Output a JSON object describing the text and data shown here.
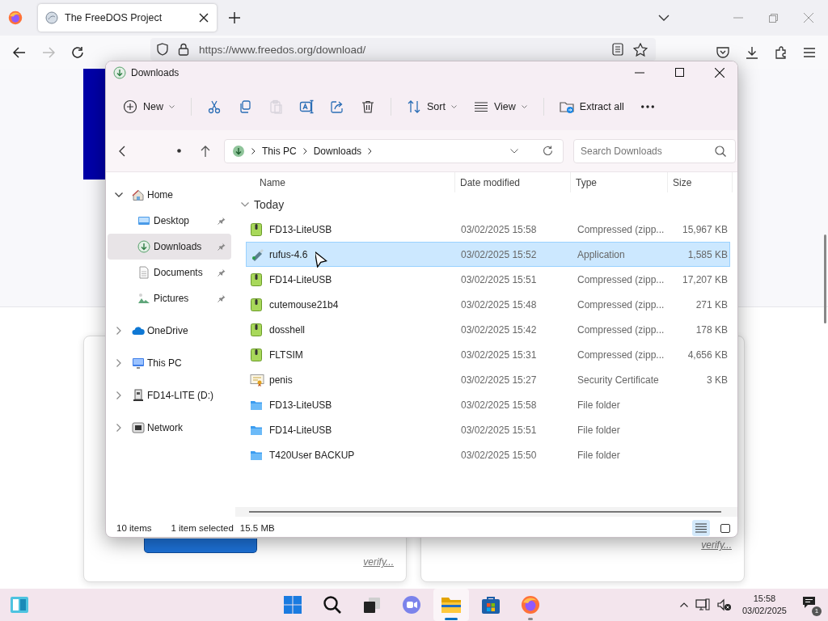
{
  "browser": {
    "tab_title": "The FreeDOS Project",
    "url": "https://www.freedos.org/download/"
  },
  "page": {
    "links": [
      "verify...",
      "verify..."
    ]
  },
  "explorer": {
    "title": "Downloads",
    "command_groups": [
      [
        {
          "kind": "new",
          "label": "New",
          "dropdown": true,
          "disabled": false
        }
      ],
      [
        {
          "kind": "cut",
          "dropdown": false,
          "disabled": false
        },
        {
          "kind": "copy",
          "dropdown": false,
          "disabled": false
        },
        {
          "kind": "paste",
          "dropdown": false,
          "disabled": true
        },
        {
          "kind": "rename",
          "dropdown": false,
          "disabled": false
        },
        {
          "kind": "share",
          "dropdown": false,
          "disabled": false
        },
        {
          "kind": "delete",
          "dropdown": false,
          "disabled": false
        }
      ],
      [
        {
          "kind": "sort",
          "label": "Sort",
          "dropdown": true,
          "disabled": false
        },
        {
          "kind": "view",
          "label": "View",
          "dropdown": true,
          "disabled": false
        }
      ],
      [
        {
          "kind": "extract",
          "label": "Extract all",
          "dropdown": false,
          "disabled": false
        },
        {
          "kind": "more",
          "dropdown": false,
          "disabled": false
        }
      ]
    ],
    "address": {
      "crumbs": [
        "This PC",
        "Downloads"
      ]
    },
    "search": {
      "placeholder": "Search Downloads"
    },
    "sidebar": [
      {
        "label": "Home",
        "kind": "home",
        "expanded": true,
        "selected": false,
        "children": [
          {
            "label": "Desktop",
            "kind": "desktop",
            "pinned": true,
            "selected": false
          },
          {
            "label": "Downloads",
            "kind": "downloads",
            "pinned": true,
            "selected": true
          },
          {
            "label": "Documents",
            "kind": "documents",
            "pinned": true,
            "selected": false
          },
          {
            "label": "Pictures",
            "kind": "pictures",
            "pinned": true,
            "selected": false
          }
        ]
      },
      {
        "label": "OneDrive",
        "kind": "cloud",
        "expanded": false,
        "selected": false
      },
      {
        "label": "This PC",
        "kind": "pc",
        "expanded": false,
        "selected": false
      },
      {
        "label": "FD14-LITE (D:)",
        "kind": "drive",
        "expanded": false,
        "selected": false
      },
      {
        "label": "Network",
        "kind": "network",
        "expanded": false,
        "selected": false
      }
    ],
    "columns": [
      "Name",
      "Date modified",
      "Type",
      "Size"
    ],
    "group": {
      "label": "Today",
      "expanded": true
    },
    "rows": [
      {
        "name": "FD13-LiteUSB",
        "kind": "zip",
        "date": "03/02/2025 15:58",
        "type": "Compressed (zipp...",
        "size": "15,967 KB",
        "selected": false
      },
      {
        "name": "rufus-4.6",
        "kind": "app",
        "date": "03/02/2025 15:52",
        "type": "Application",
        "size": "1,585 KB",
        "selected": true
      },
      {
        "name": "FD14-LiteUSB",
        "kind": "zip",
        "date": "03/02/2025 15:51",
        "type": "Compressed (zipp...",
        "size": "17,207 KB",
        "selected": false
      },
      {
        "name": "cutemouse21b4",
        "kind": "zip",
        "date": "03/02/2025 15:48",
        "type": "Compressed (zipp...",
        "size": "271 KB",
        "selected": false
      },
      {
        "name": "dosshell",
        "kind": "zip",
        "date": "03/02/2025 15:42",
        "type": "Compressed (zipp...",
        "size": "178 KB",
        "selected": false
      },
      {
        "name": "FLTSIM",
        "kind": "zip",
        "date": "03/02/2025 15:31",
        "type": "Compressed (zipp...",
        "size": "4,656 KB",
        "selected": false
      },
      {
        "name": "penis",
        "kind": "cert",
        "date": "03/02/2025 15:27",
        "type": "Security Certificate",
        "size": "3 KB",
        "selected": false
      },
      {
        "name": "FD13-LiteUSB",
        "kind": "folder",
        "date": "03/02/2025 15:58",
        "type": "File folder",
        "selected": false
      },
      {
        "name": "FD14-LiteUSB",
        "kind": "folder",
        "date": "03/02/2025 15:51",
        "type": "File folder",
        "selected": false
      },
      {
        "name": "T420User BACKUP",
        "kind": "folder",
        "date": "03/02/2025 15:50",
        "type": "File folder",
        "selected": false
      }
    ],
    "status": {
      "count": "10 items",
      "selection": "1 item selected",
      "size": "15.5 MB"
    },
    "views": [
      {
        "kind": "details",
        "selected": true
      },
      {
        "kind": "tiles",
        "selected": false
      }
    ]
  },
  "taskbar": {
    "apps": [
      {
        "kind": "start",
        "active": false,
        "running": false
      },
      {
        "kind": "search",
        "active": false,
        "running": false
      },
      {
        "kind": "taskview",
        "active": false,
        "running": false
      },
      {
        "kind": "chat",
        "active": false,
        "running": false
      },
      {
        "kind": "explorer",
        "active": true,
        "running": true
      },
      {
        "kind": "store",
        "active": false,
        "running": false
      },
      {
        "kind": "firefox",
        "active": false,
        "running": true
      }
    ],
    "time": "15:58",
    "date": "03/02/2025",
    "notifications": "1"
  }
}
